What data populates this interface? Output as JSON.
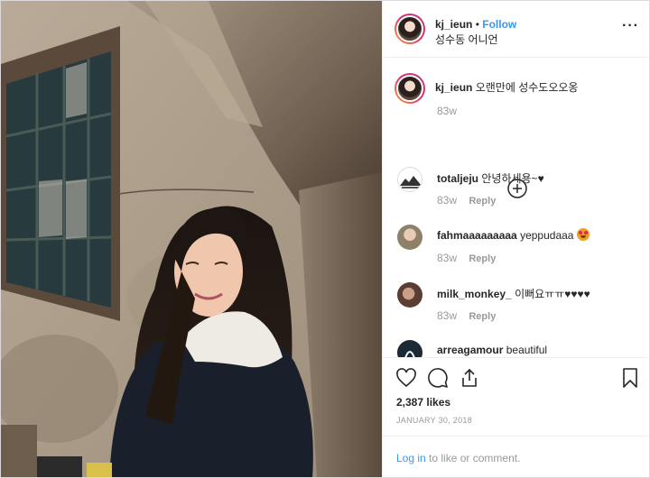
{
  "post": {
    "username": "kj_ieun",
    "separator": "•",
    "follow_label": "Follow",
    "location": "성수동 어니언",
    "caption": "오랜만에 성수도오오옹",
    "caption_time": "83w",
    "likes": "2,387 likes",
    "date": "JANUARY 30, 2018",
    "photo_alt": "photo"
  },
  "comments": [
    {
      "username": "totaljeju",
      "text": "안녕하세용~♥",
      "time": "83w",
      "reply": "Reply"
    },
    {
      "username": "fahmaaaaaaaaa",
      "text": "yeppudaaa",
      "time": "83w",
      "reply": "Reply"
    },
    {
      "username": "milk_monkey_",
      "text": "이뻐요ㅠㅠ♥♥♥♥",
      "time": "83w",
      "reply": "Reply"
    },
    {
      "username": "arreagamour",
      "text": "beautiful"
    }
  ],
  "footer": {
    "login_link": "Log in",
    "login_suffix": "to like or comment."
  },
  "icons": {
    "more": "more-options-icon",
    "load_more": "plus-circle-icon",
    "like": "heart-icon",
    "comment": "comment-icon",
    "share": "share-icon",
    "save": "bookmark-icon",
    "emoji": "heart-eyes-emoji"
  },
  "colors": {
    "link": "#3897f0",
    "muted": "#999999",
    "border": "#efefef"
  }
}
